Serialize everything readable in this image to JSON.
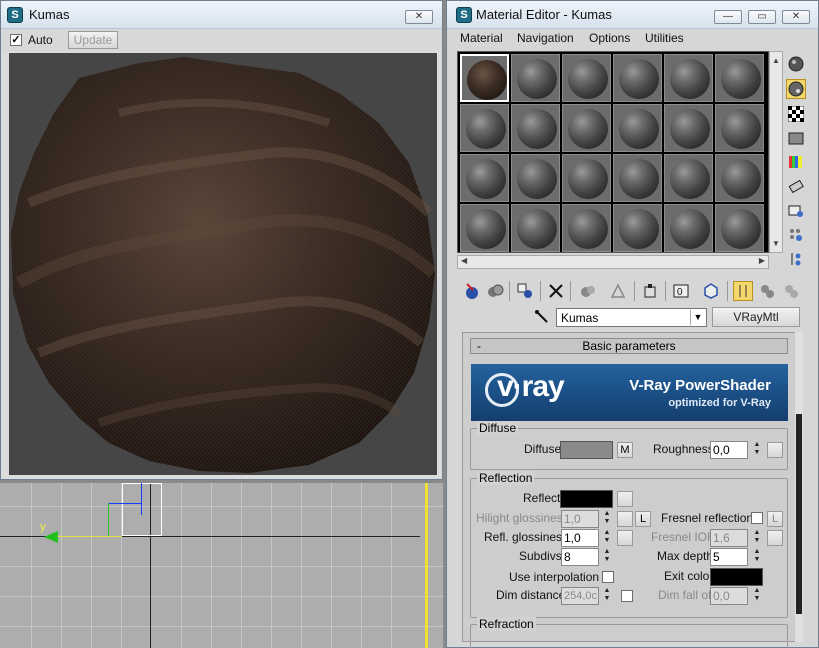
{
  "render_window": {
    "title": "Kumas",
    "auto_label": "Auto",
    "auto_checked": true,
    "update_label": "Update"
  },
  "viewport": {
    "axis_label": "y"
  },
  "material_editor": {
    "title": "Material Editor - Kumas",
    "menu": [
      "Material",
      "Navigation",
      "Options",
      "Utilities"
    ],
    "material_name": "Kumas",
    "material_type": "VRayMtl",
    "rollout_collapse": "-",
    "rollout_title": "Basic parameters",
    "banner": {
      "logo_text": "v·ray",
      "headline": "V-Ray PowerShader",
      "subline": "optimized for V-Ray"
    },
    "diffuse": {
      "group": "Diffuse",
      "diffuse_label": "Diffuse",
      "map_button": "M",
      "roughness_label": "Roughness",
      "roughness_value": "0,0",
      "diffuse_color": "#8a8a8a"
    },
    "reflection": {
      "group": "Reflection",
      "reflect_label": "Reflect",
      "reflect_color": "#000000",
      "hilight_label": "Hilight glossiness",
      "hilight_value": "1,0",
      "lock_label": "L",
      "fresnel_label": "Fresnel reflections",
      "fresnel_lock": "L",
      "refl_gloss_label": "Refl. glossiness",
      "refl_gloss_value": "1,0",
      "fresnel_ior_label": "Fresnel IOR",
      "fresnel_ior_value": "1,6",
      "subdivs_label": "Subdivs",
      "subdivs_value": "8",
      "max_depth_label": "Max depth",
      "max_depth_value": "5",
      "use_interp_label": "Use interpolation",
      "exit_color_label": "Exit color",
      "exit_color": "#000000",
      "dim_distance_label": "Dim distance",
      "dim_distance_value": "254,0c",
      "dim_falloff_label": "Dim fall off",
      "dim_falloff_value": "0,0"
    },
    "refraction": {
      "group": "Refraction"
    },
    "side_tools": [
      "sample-type-icon",
      "backlight-icon",
      "background-checker-icon",
      "sample-uv-icon",
      "video-color-check-icon",
      "make-preview-icon",
      "options-icon",
      "select-by-material-icon",
      "material-navigator-icon"
    ],
    "toolbar_icons": [
      "get-material-icon",
      "put-to-scene-icon",
      "assign-to-selection-icon",
      "reset-map-icon",
      "make-unique-icon",
      "put-to-library-icon",
      "material-id-channel-icon",
      "show-map-in-viewport-icon",
      "show-end-result-icon",
      "go-to-parent-icon",
      "go-forward-sibling-icon"
    ]
  },
  "colors": {
    "accent_yellow": "#f0e030",
    "vray_blue": "#1b4f8c"
  }
}
